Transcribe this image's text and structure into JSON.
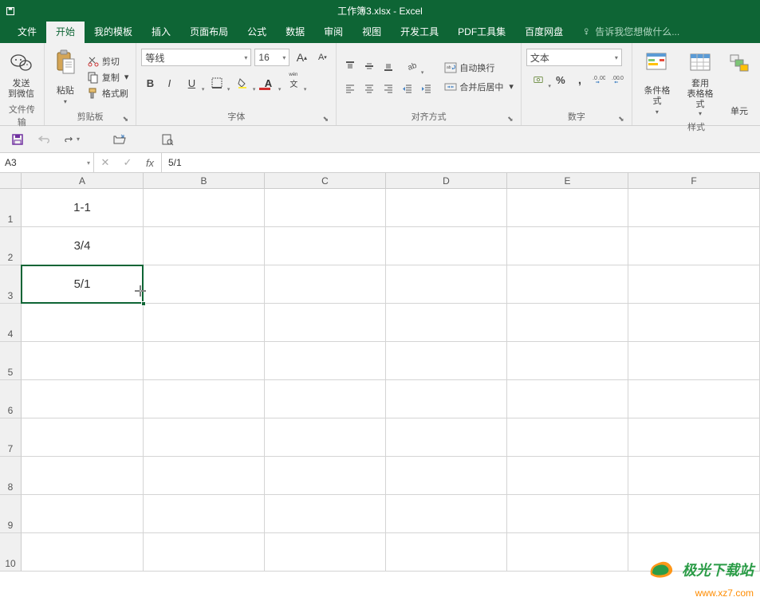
{
  "title": "工作簿3.xlsx - Excel",
  "tabs": [
    "文件",
    "开始",
    "我的模板",
    "插入",
    "页面布局",
    "公式",
    "数据",
    "审阅",
    "视图",
    "开发工具",
    "PDF工具集",
    "百度网盘"
  ],
  "tab_active_index": 1,
  "tell_me": "告诉我您想做什么...",
  "ribbon": {
    "wechat": {
      "label": "发送\n到微信",
      "group": "文件传输"
    },
    "clipboard": {
      "paste": "粘贴",
      "cut": "剪切",
      "copy": "复制",
      "format_painter": "格式刷",
      "group": "剪贴板"
    },
    "font": {
      "name": "等线",
      "size": "16",
      "group": "字体"
    },
    "align": {
      "wrap": "自动换行",
      "merge": "合并后居中",
      "group": "对齐方式"
    },
    "number": {
      "format": "文本",
      "group": "数字"
    },
    "styles": {
      "cond": "条件格式",
      "table": "套用\n表格格式",
      "cell": "单元",
      "group": "样式"
    }
  },
  "name_box": "A3",
  "formula": "5/1",
  "columns": [
    "A",
    "B",
    "C",
    "D",
    "E",
    "F"
  ],
  "rows": [
    "1",
    "2",
    "3",
    "4",
    "5",
    "6",
    "7",
    "8",
    "9",
    "10"
  ],
  "cells": {
    "A1": "1-1",
    "A2": "3/4",
    "A3": "5/1"
  },
  "watermark": {
    "name": "极光下载站",
    "url": "www.xz7.com"
  }
}
